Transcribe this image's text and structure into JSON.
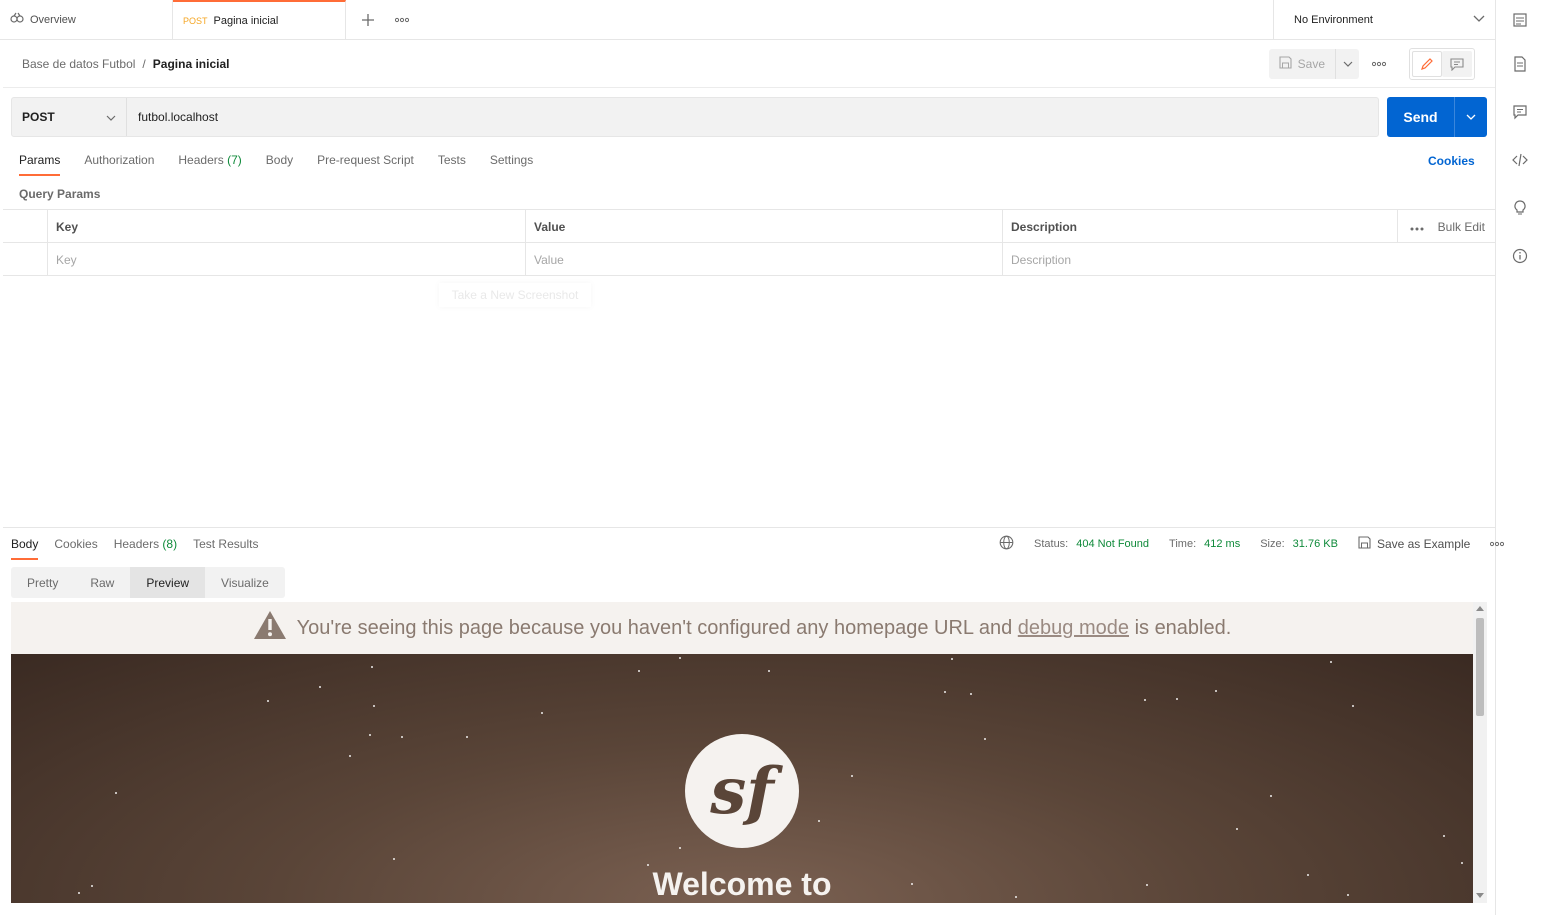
{
  "tabs": [
    {
      "label": "Overview",
      "icon": "overview-icon"
    },
    {
      "method": "POST",
      "label": "Pagina inicial",
      "active": true
    }
  ],
  "environment": {
    "selected": "No Environment"
  },
  "breadcrumb": {
    "collection": "Base de datos Futbol",
    "separator": "/",
    "request": "Pagina inicial"
  },
  "toolbar": {
    "save_label": "Save"
  },
  "request": {
    "method": "POST",
    "url": "futbol.localhost",
    "send_label": "Send"
  },
  "request_tabs": [
    {
      "label": "Params",
      "active": true
    },
    {
      "label": "Authorization"
    },
    {
      "label": "Headers",
      "count": "(7)"
    },
    {
      "label": "Body"
    },
    {
      "label": "Pre-request Script"
    },
    {
      "label": "Tests"
    },
    {
      "label": "Settings"
    }
  ],
  "cookies_label": "Cookies",
  "query_params": {
    "title": "Query Params",
    "columns": [
      "Key",
      "Value",
      "Description"
    ],
    "placeholders": [
      "Key",
      "Value",
      "Description"
    ],
    "bulk_edit_label": "Bulk Edit"
  },
  "ghost_tooltip": "Take a New Screenshot",
  "response": {
    "tabs": [
      {
        "label": "Body",
        "active": true
      },
      {
        "label": "Cookies"
      },
      {
        "label": "Headers",
        "count": "(8)"
      },
      {
        "label": "Test Results"
      }
    ],
    "status_label": "Status:",
    "status_value": "404 Not Found",
    "time_label": "Time:",
    "time_value": "412 ms",
    "size_label": "Size:",
    "size_value": "31.76 KB",
    "save_example_label": "Save as Example",
    "views": [
      {
        "label": "Pretty"
      },
      {
        "label": "Raw"
      },
      {
        "label": "Preview",
        "active": true
      },
      {
        "label": "Visualize"
      }
    ]
  },
  "preview": {
    "banner_before": "You're seeing this page because you haven't configured any homepage URL and",
    "banner_link": "debug mode",
    "banner_after": "is enabled.",
    "logo_text": "sf",
    "welcome": "Welcome to"
  },
  "colors": {
    "accent": "#ff6c37",
    "primary": "#0265d2",
    "success": "#0f8a3a"
  }
}
